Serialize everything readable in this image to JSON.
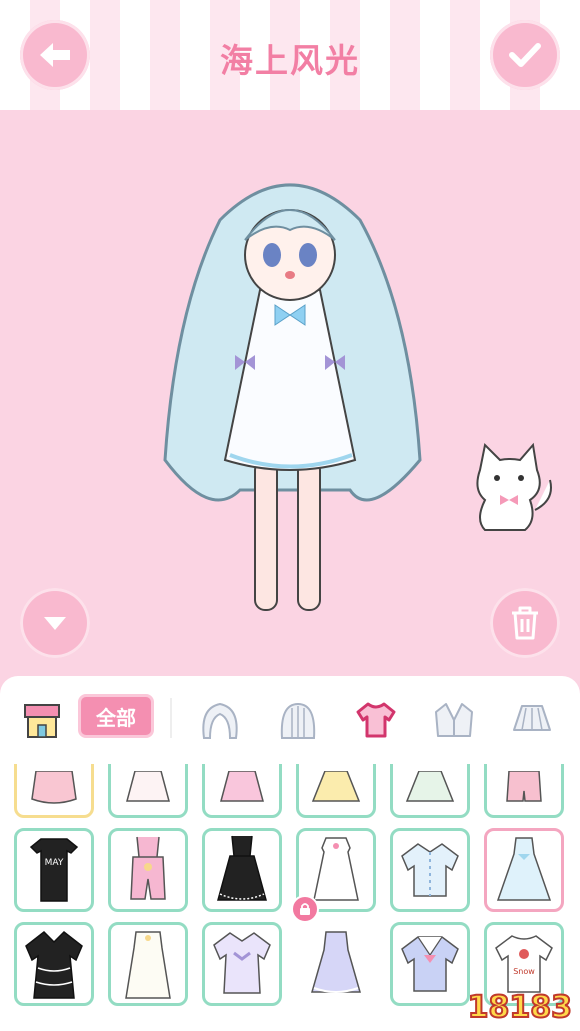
{
  "header": {
    "title": "海上风光"
  },
  "colors": {
    "background": "#fbd4e3",
    "accent": "#f48fb1",
    "item_border": "#93dcc3",
    "selected_border": "#f4a6c0"
  },
  "buttons": {
    "back": "back-arrow-icon",
    "confirm": "check-icon",
    "down": "chevron-down-icon",
    "delete": "trash-icon"
  },
  "toolbar": {
    "shop": "shop-icon",
    "all_label": "全部",
    "categories": [
      "hair-front-icon",
      "hair-back-icon",
      "top-icon",
      "jacket-icon",
      "skirt-icon"
    ]
  },
  "items": [
    "pink-ruffle-top",
    "white-dress",
    "pink-dress",
    "yellow-dress",
    "green-dress",
    "pink-romper",
    "black-tshirt-may",
    "pink-overalls",
    "black-pinafore",
    "white-nightgown",
    "blue-blouse",
    "blue-babydoll",
    "black-lace-dress",
    "white-slip-dress",
    "lavender-shirt",
    "lavender-dress",
    "sailor-top",
    "white-tshirt"
  ],
  "item_texts": {
    "black_tshirt": "MAY",
    "white_tshirt": "Snow"
  },
  "watermark": "18183"
}
